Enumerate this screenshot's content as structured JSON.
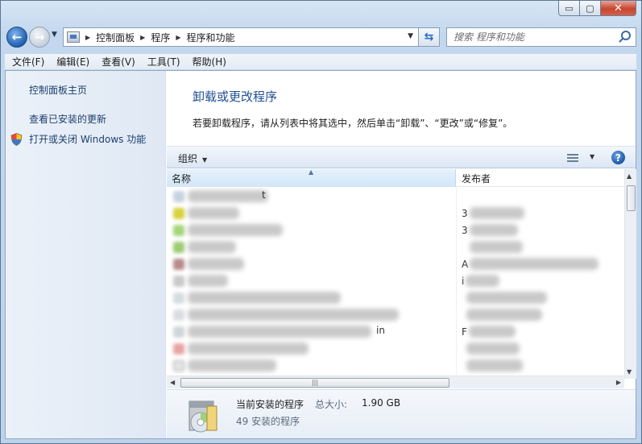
{
  "window": {
    "buttons": {
      "minimize": "▭",
      "maximize": "▢",
      "close": "✕"
    }
  },
  "nav": {
    "breadcrumb": [
      "控制面板",
      "程序",
      "程序和功能"
    ],
    "search_placeholder": "搜索 程序和功能"
  },
  "menu": [
    "文件(F)",
    "编辑(E)",
    "查看(V)",
    "工具(T)",
    "帮助(H)"
  ],
  "sidebar": {
    "links": [
      "控制面板主页",
      "查看已安装的更新",
      "打开或关闭 Windows 功能"
    ]
  },
  "main": {
    "title": "卸载或更改程序",
    "description": "若要卸载程序，请从列表中将其选中，然后单击“卸载”、“更改”或“修复”。"
  },
  "toolbar": {
    "organize": "组织"
  },
  "columns": {
    "name": "名称",
    "publisher": "发布者"
  },
  "rows": [
    {
      "name_tail": "t",
      "pub_lead": ""
    },
    {
      "name_tail": "",
      "pub_lead": "3"
    },
    {
      "name_tail": "",
      "pub_lead": "3"
    },
    {
      "name_tail": "",
      "pub_lead": ""
    },
    {
      "name_tail": "",
      "pub_lead": "A"
    },
    {
      "name_tail": "",
      "pub_lead": "i"
    },
    {
      "name_tail": "",
      "pub_lead": ""
    },
    {
      "name_tail": "",
      "pub_lead": ""
    },
    {
      "name_tail": "in",
      "pub_lead": "F"
    },
    {
      "name_tail": "",
      "pub_lead": ""
    },
    {
      "name_tail": "",
      "pub_lead": ""
    }
  ],
  "details": {
    "title": "当前安装的程序",
    "size_label": "总大小:",
    "size_value": "1.90 GB",
    "count": "49 安装的程序"
  },
  "colors": {
    "link": "#1e3f6e",
    "title": "#1e4f91",
    "accent": "#2a6ac2"
  },
  "icons": [
    "back-icon",
    "forward-icon",
    "folder-icon",
    "refresh-icon",
    "search-icon",
    "shield-icon",
    "view-icon",
    "help-icon",
    "program-package-icon"
  ]
}
